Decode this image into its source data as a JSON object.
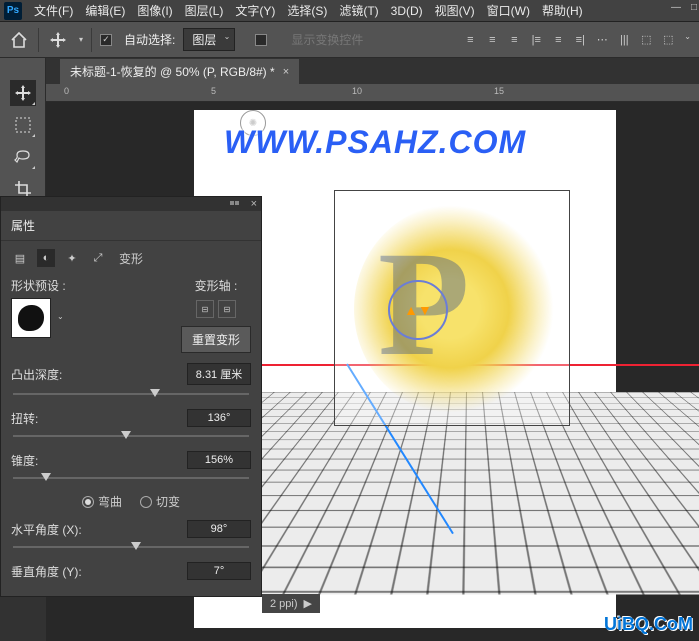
{
  "menubar": {
    "logo": "Ps",
    "items": [
      "文件(F)",
      "编辑(E)",
      "图像(I)",
      "图层(L)",
      "文字(Y)",
      "选择(S)",
      "滤镜(T)",
      "3D(D)",
      "视图(V)",
      "窗口(W)",
      "帮助(H)"
    ]
  },
  "optionsbar": {
    "auto_select_label": "自动选择:",
    "layer_select": "图层",
    "show_transform": "显示变换控件"
  },
  "document_tab": {
    "title": "未标题-1-恢复的 @ 50% (P, RGB/8#) *"
  },
  "ruler_ticks": [
    "0",
    "5",
    "10",
    "15"
  ],
  "watermark": "WWW.PSAHZ.COM",
  "watermark_bottom": "UiBQ.CoM",
  "status": "2 ppi)",
  "properties_panel": {
    "title": "属性",
    "subtab_label": "变形",
    "shape_preset_label": "形状预设 :",
    "deform_axis_label": "变形轴 :",
    "reset_button": "重置变形",
    "extrude_depth": {
      "label": "凸出深度:",
      "value": "8.31 厘米",
      "pos": 60
    },
    "twist": {
      "label": "扭转:",
      "value": "136°",
      "pos": 48
    },
    "taper": {
      "label": "锥度:",
      "value": "156%",
      "pos": 14
    },
    "bend_radio": {
      "bend": "弯曲",
      "shear": "切变",
      "selected": "bend"
    },
    "h_angle": {
      "label": "水平角度 (X):",
      "value": "98°",
      "pos": 52
    },
    "v_angle": {
      "label": "垂直角度 (Y):",
      "value": "7°"
    }
  }
}
